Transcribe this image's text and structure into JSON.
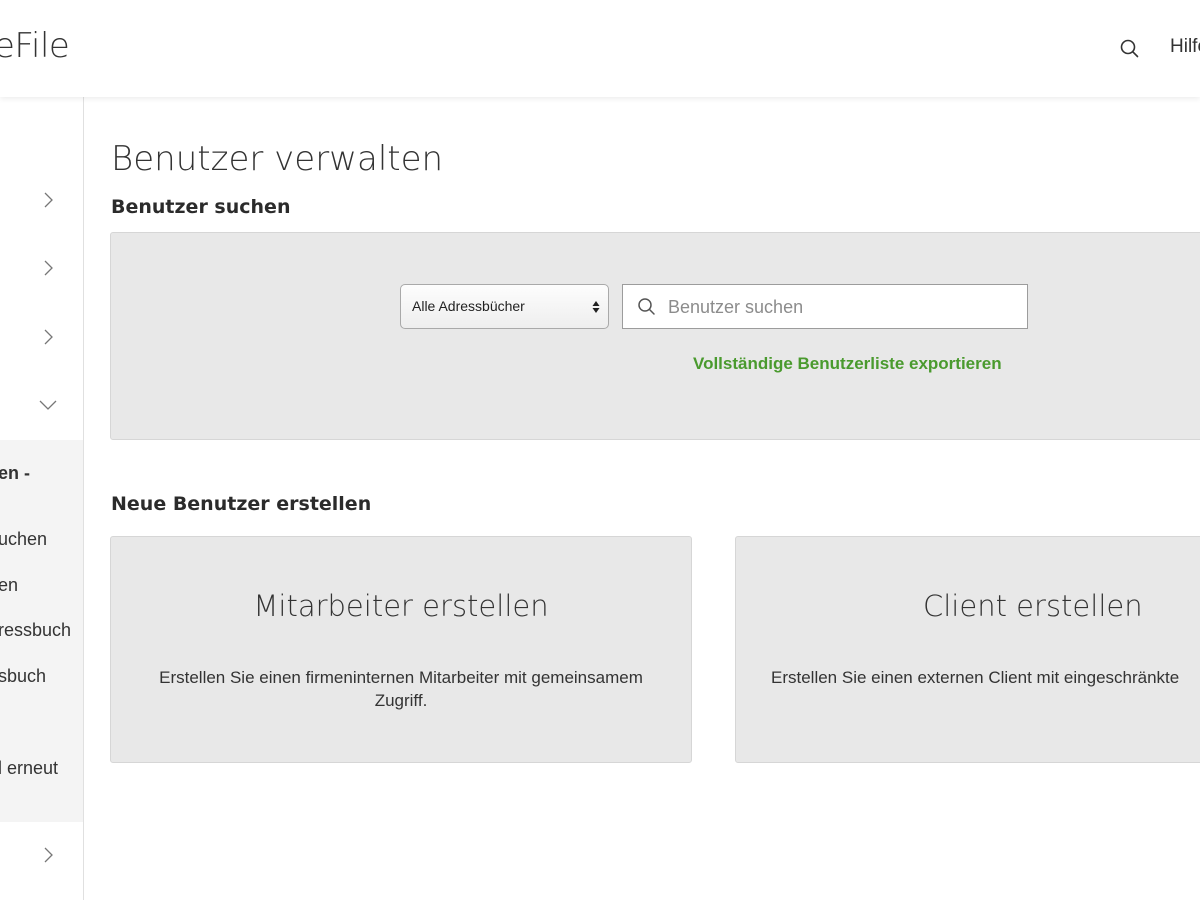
{
  "header": {
    "logo_text": "eFile",
    "help_label": "Hilfe"
  },
  "sidebar": {
    "sub_items": [
      "en -",
      "uchen",
      "en",
      "ressbuch",
      "sbuch",
      "l erneut"
    ]
  },
  "main": {
    "page_title": "Benutzer verwalten",
    "search_section": {
      "heading": "Benutzer suchen",
      "address_book_select": "Alle Adressbücher",
      "search_placeholder": "Benutzer suchen",
      "export_link": "Vollständige Benutzerliste exportieren"
    },
    "create_section": {
      "heading": "Neue Benutzer erstellen",
      "cards": [
        {
          "title": "Mitarbeiter erstellen",
          "description": "Erstellen Sie einen firmeninternen Mitarbeiter mit gemeinsamem Zugriff."
        },
        {
          "title": "Client erstellen",
          "description": "Erstellen Sie einen externen Client mit eingeschränkte"
        }
      ]
    }
  },
  "colors": {
    "accent_green": "#4a9a2e",
    "panel_gray": "#e8e8e8"
  }
}
